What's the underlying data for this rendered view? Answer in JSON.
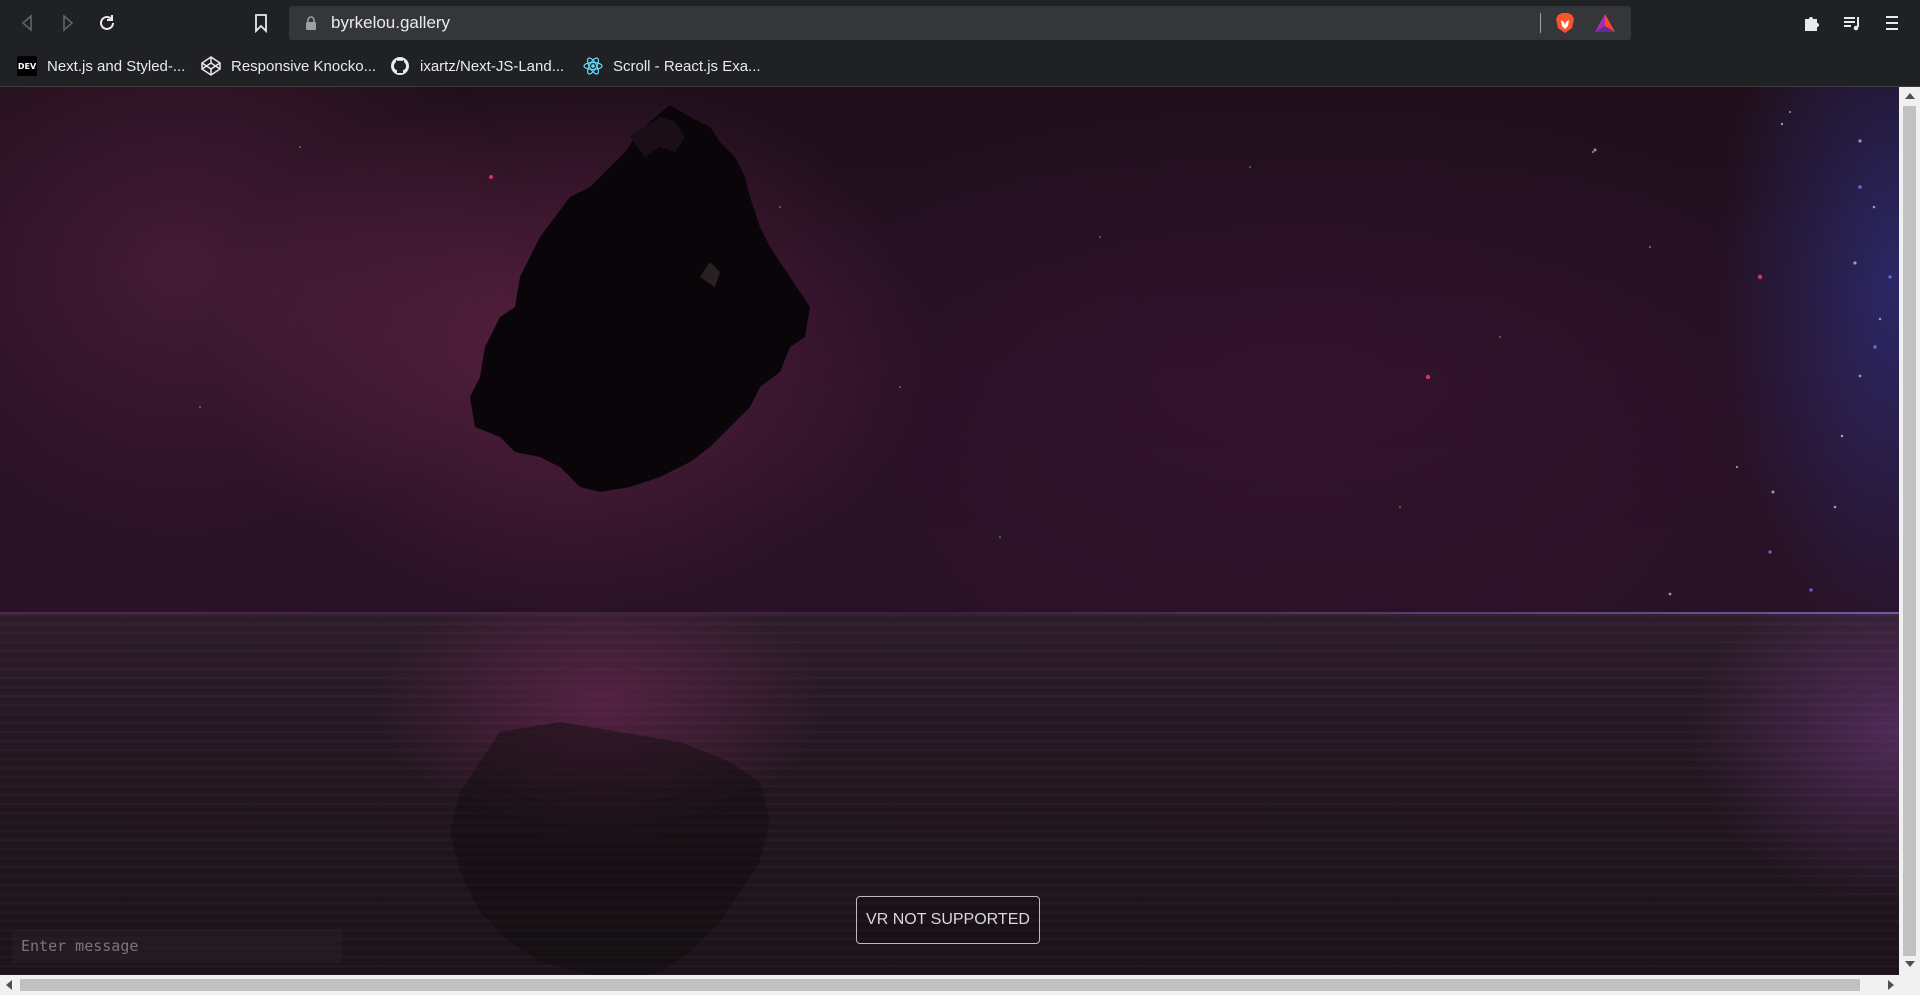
{
  "browser": {
    "url": "byrkelou.gallery",
    "icons": {
      "back": "back-arrow-icon",
      "forward": "forward-arrow-icon",
      "reload": "reload-icon",
      "bookmark": "bookmark-icon",
      "lock": "lock-icon",
      "brave_shield": "brave-lion-icon",
      "rewards": "bat-triangle-icon",
      "extensions": "puzzle-icon",
      "playlist": "playlist-icon",
      "menu": "menu-icon"
    },
    "colors": {
      "brave_orange": "#fb542b",
      "rewards_purple": "#a52cb4"
    }
  },
  "bookmarks": [
    {
      "label": "Next.js and Styled-...",
      "icon": "dev-icon",
      "icon_text": "DEV"
    },
    {
      "label": "Responsive Knocko...",
      "icon": "codepen-icon"
    },
    {
      "label": "ixartz/Next-JS-Land...",
      "icon": "github-icon"
    },
    {
      "label": "Scroll - React.js Exa...",
      "icon": "react-icon"
    }
  ],
  "scene": {
    "vr_button_label": "VR NOT SUPPORTED",
    "message_placeholder": "Enter message"
  }
}
